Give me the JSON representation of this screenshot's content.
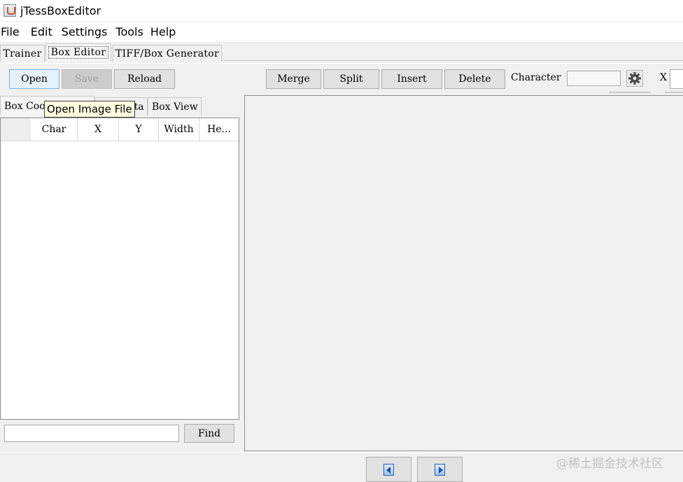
{
  "window": {
    "title": "jTessBoxEditor"
  },
  "menu": {
    "items": [
      "File",
      "Edit",
      "Settings",
      "Tools",
      "Help"
    ]
  },
  "main_tabs": [
    "Trainer",
    "Box Editor",
    "TIFF/Box Generator"
  ],
  "toolbar": {
    "open_label": "Open",
    "save_label": "Save",
    "reload_label": "Reload",
    "merge_label": "Merge",
    "split_label": "Split",
    "insert_label": "Insert",
    "delete_label": "Delete",
    "character_label": "Character",
    "character_value": "",
    "x_label": "X",
    "x_value": ""
  },
  "sub_tabs": [
    "Box Coordinates",
    "Box Data",
    "Box View"
  ],
  "table": {
    "columns": [
      "",
      "Char",
      "X",
      "Y",
      "Width",
      "He..."
    ]
  },
  "find": {
    "value": "",
    "button_label": "Find"
  },
  "tooltip": {
    "text": "Open Image File"
  },
  "watermark": {
    "text": "@稀土掘金技术社区"
  }
}
